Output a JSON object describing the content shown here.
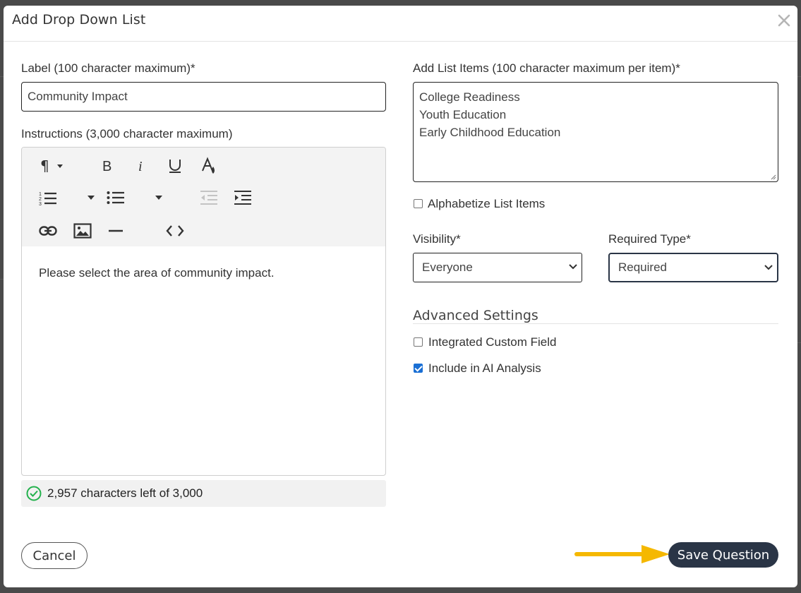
{
  "modal": {
    "title": "Add Drop Down List",
    "close_icon": "close-icon"
  },
  "label_field": {
    "label": "Label (100 character maximum)*",
    "value": "Community Impact"
  },
  "instructions": {
    "label": "Instructions (3,000 character maximum)",
    "body": "Please select the area of community impact.",
    "char_count": "2,957 characters left of 3,000",
    "toolbar": [
      "paragraph-icon",
      "bold-icon",
      "italic-icon",
      "underline-icon",
      "text-color-icon",
      "ordered-list-icon",
      "unordered-list-icon",
      "outdent-icon",
      "indent-icon",
      "link-icon",
      "image-icon",
      "horizontal-rule-icon",
      "code-view-icon"
    ]
  },
  "list_items": {
    "label": "Add List Items (100 character maximum per item)*",
    "items": [
      "College Readiness",
      "Youth Education",
      "Early Childhood Education"
    ]
  },
  "alphabetize": {
    "label": "Alphabetize List Items",
    "checked": false
  },
  "visibility": {
    "label": "Visibility*",
    "value": "Everyone"
  },
  "required_type": {
    "label": "Required Type*",
    "value": "Required"
  },
  "advanced": {
    "title": "Advanced Settings",
    "integrated_custom_field": {
      "label": "Integrated Custom Field",
      "checked": false
    },
    "include_ai": {
      "label": "Include in AI Analysis",
      "checked": true
    }
  },
  "footer": {
    "cancel_label": "Cancel",
    "save_label": "Save Question"
  },
  "colors": {
    "save_button": "#2a3546",
    "arrow": "#f5b800",
    "check_accent": "#1a6fd4",
    "success_icon": "#22b14c"
  }
}
